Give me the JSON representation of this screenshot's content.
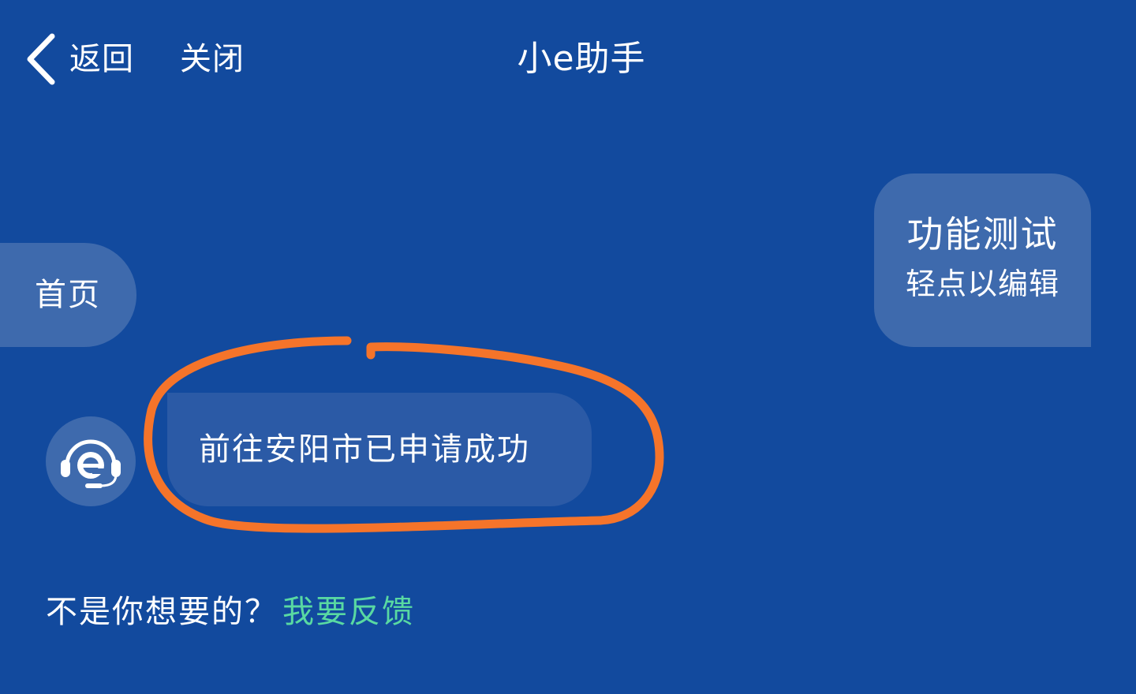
{
  "header": {
    "back_label": "返回",
    "close_label": "关闭",
    "title": "小e助手"
  },
  "conversation": {
    "user_message": {
      "text": "功能测试",
      "hint": "轻点以编辑"
    },
    "quick_chip": {
      "label": "首页"
    },
    "bot_message": {
      "text": "前往安阳市已申请成功"
    }
  },
  "feedback": {
    "prompt": "不是你想要的？",
    "link": "我要反馈"
  },
  "colors": {
    "background": "#124a9e",
    "bubble": "#3e6aad",
    "bot_bubble": "#2b5aa6",
    "link": "#59d9a2",
    "annotation": "#f5742a"
  },
  "icons": {
    "back": "chevron-left-icon",
    "avatar": "headset-e-icon"
  }
}
